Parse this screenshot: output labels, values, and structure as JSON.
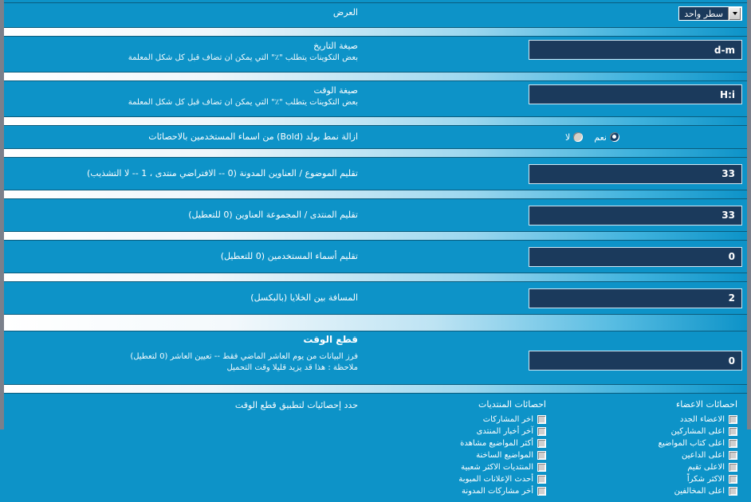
{
  "colors": {
    "background": "#0d93c8",
    "input_bg": "#1b3a5c",
    "border_dark": "#0a5c7d",
    "frame_gray": "#7b808b",
    "text": "#ffffff"
  },
  "rows": {
    "display": {
      "label": "العرض",
      "select_value": "سطر واحد"
    },
    "date_format": {
      "label": "صيغة التاريخ",
      "desc": "بعض التكوينات يتطلب \"٪\" التي يمكن ان تضاف قبل كل شكل المعلمة",
      "value": "d-m"
    },
    "time_format": {
      "label": "صيغة الوقت",
      "desc": "بعض التكوينات يتطلب \"٪\" التي يمكن ان تضاف قبل كل شكل المعلمة",
      "value": "H:i"
    },
    "remove_bold": {
      "label": "ازالة نمط بولد (Bold) من اسماء المستخدمين بالاحصائات",
      "yes_label": "نعم",
      "no_label": "لا",
      "selected": "yes"
    },
    "trim_topic": {
      "label": "تقليم الموضوع / العناوين المدونة (0 -- الافتراضي منتدى ، 1 -- لا التشذيب)",
      "value": "33"
    },
    "trim_forum": {
      "label": "تقليم المنتدى / المجموعة العناوين (0 للتعطيل)",
      "value": "33"
    },
    "trim_username": {
      "label": "تقليم أسماء المستخدمين (0 للتعطيل)",
      "value": "0"
    },
    "cell_spacing": {
      "label": "المسافة بين الخلايا (بالبكسل)",
      "value": "2"
    },
    "time_cut_header": {
      "label": "قطع الوقت"
    },
    "time_cut_value": {
      "desc_line1": "فرز البيانات من يوم العاشر الماضي فقط -- تعيين العاشر (0 لتعطيل)",
      "desc_line2": "ملاحظة : هذا قد يزيد قليلا وقت التحميل",
      "value": "0"
    },
    "select_stats": {
      "label": "حدد إحصائيات لتطبيق قطع الوقت"
    }
  },
  "columns": {
    "members": {
      "caption": "احصائات الاعضاء",
      "items": [
        {
          "label": "الاعضاء الجدد",
          "checked": false
        },
        {
          "label": "اعلى المشاركين",
          "checked": false
        },
        {
          "label": "اعلى كتاب المواضيع",
          "checked": false
        },
        {
          "label": "اعلى الداعين",
          "checked": false
        },
        {
          "label": "الاعلى تقيم",
          "checked": false
        },
        {
          "label": "الاكثر شكراً",
          "checked": false
        },
        {
          "label": "اعلى المخالفين",
          "checked": false
        }
      ]
    },
    "forums": {
      "caption": "احصائات المنتديات",
      "items": [
        {
          "label": "اخر المشاركات",
          "checked": false
        },
        {
          "label": "آخر أخبار المنتدى",
          "checked": false
        },
        {
          "label": "أكثر المواضيع مشاهدة",
          "checked": false
        },
        {
          "label": "المواضيع الساخنة",
          "checked": false
        },
        {
          "label": "المنتديات الاكثر شعبية",
          "checked": false
        },
        {
          "label": "أحدث الإعلانات المبوبة",
          "checked": false
        },
        {
          "label": "أخر مشاركات المدونة",
          "checked": false
        }
      ]
    }
  },
  "icons": {
    "dropdown": "chevron-down-icon"
  }
}
